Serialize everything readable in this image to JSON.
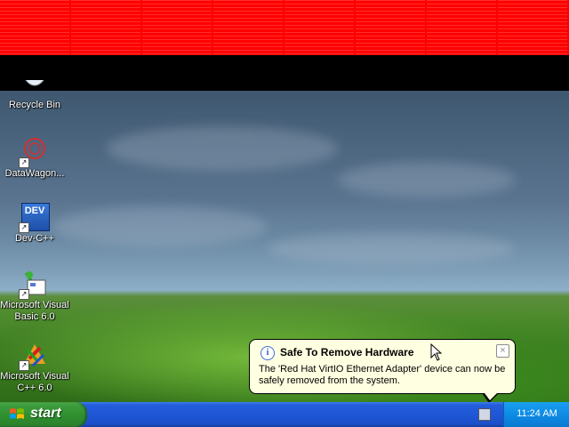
{
  "desktop": {
    "icons": [
      {
        "label": "Recycle Bin",
        "icon": "recycle-bin-icon"
      },
      {
        "label": "DataWagon...",
        "icon": "datawagon-icon"
      },
      {
        "label": "Dev-C++",
        "icon": "dev-cpp-icon",
        "badge": "DEV"
      },
      {
        "label": "Microsoft Visual Basic 6.0",
        "icon": "visual-basic-icon"
      },
      {
        "label": "Microsoft Visual C++ 6.0",
        "icon": "visual-cpp-icon"
      }
    ]
  },
  "balloon": {
    "title": "Safe To Remove Hardware",
    "message": "The 'Red Hat VirtIO Ethernet Adapter' device can now be safely removed from the system.",
    "icon": "info-icon",
    "close_glyph": "×",
    "info_glyph": "i"
  },
  "taskbar": {
    "start_label": "start",
    "clock": "11:24 AM",
    "tray_icon": "safely-remove-hardware-icon"
  },
  "colors": {
    "top_band": "#ff0000",
    "taskbar": "#245edb",
    "start_button": "#3c9a3c",
    "balloon_bg": "#ffffe1"
  }
}
